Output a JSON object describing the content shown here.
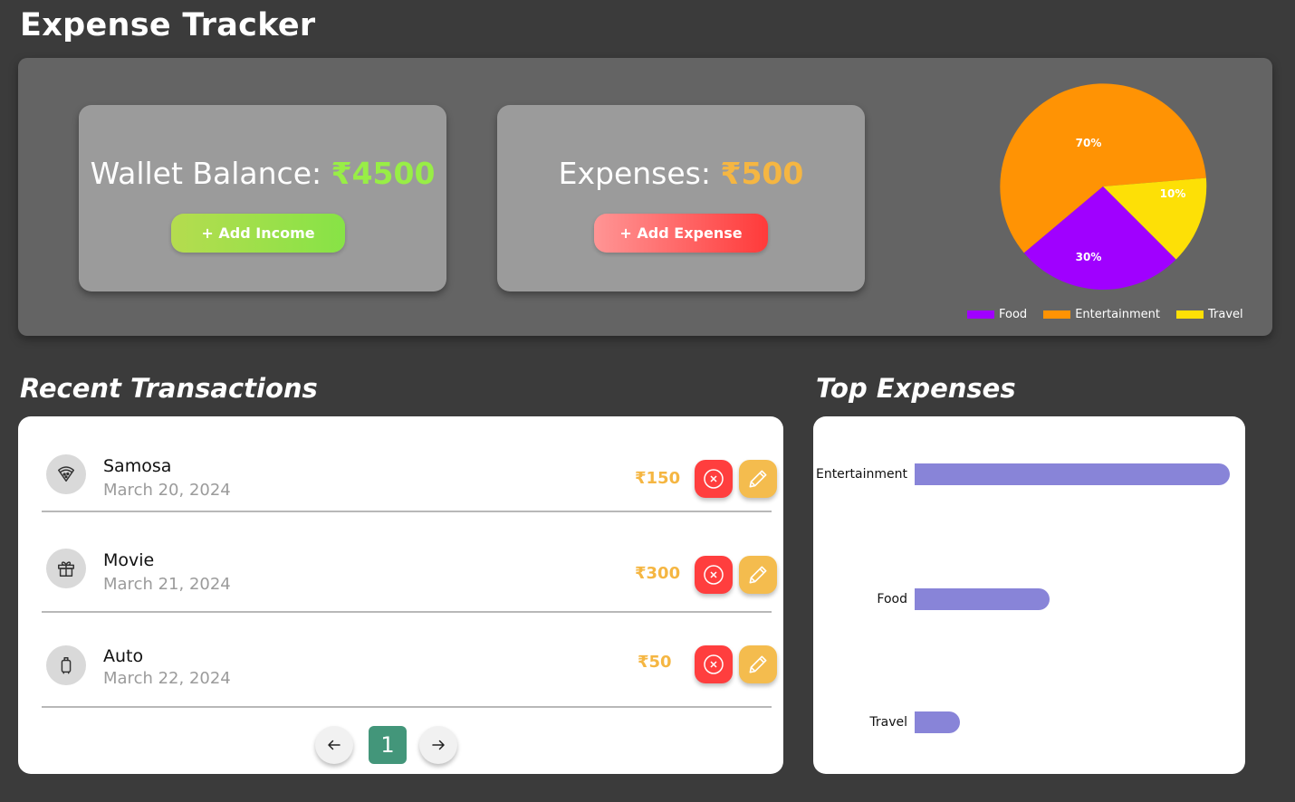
{
  "header": {
    "title": "Expense Tracker"
  },
  "wallet": {
    "label": "Wallet Balance: ",
    "amount": "₹4500",
    "button_label": "+ Add Income"
  },
  "expenses": {
    "label": "Expenses: ",
    "amount": "₹500",
    "button_label": "+ Add Expense"
  },
  "pie": {
    "slices": [
      {
        "label": "70%",
        "category": "Entertainment",
        "color": "#ff9304"
      },
      {
        "label": "10%",
        "category": "Travel",
        "color": "#fde006"
      },
      {
        "label": "30%",
        "category": "Food",
        "color": "#a000ff"
      }
    ],
    "legend": [
      {
        "label": "Food",
        "color": "#a000ff"
      },
      {
        "label": "Entertainment",
        "color": "#ff9304"
      },
      {
        "label": "Travel",
        "color": "#fde006"
      }
    ]
  },
  "recent": {
    "title": "Recent Transactions",
    "items": [
      {
        "name": "Samosa",
        "date": "March 20, 2024",
        "amount": "₹150",
        "icon": "pizza-icon"
      },
      {
        "name": "Movie",
        "date": "March 21, 2024",
        "amount": "₹300",
        "icon": "gift-icon"
      },
      {
        "name": "Auto",
        "date": "March 22, 2024",
        "amount": "₹50",
        "icon": "luggage-icon"
      }
    ],
    "pagination": {
      "current_page": "1"
    }
  },
  "top_expenses": {
    "title": "Top Expenses",
    "bar_color": "#8884d8"
  },
  "chart_data": {
    "type": "bar",
    "orientation": "horizontal",
    "categories": [
      "Entertainment",
      "Food",
      "Travel"
    ],
    "values": [
      350,
      150,
      50
    ],
    "xlim": [
      0,
      350
    ],
    "grid": false
  }
}
